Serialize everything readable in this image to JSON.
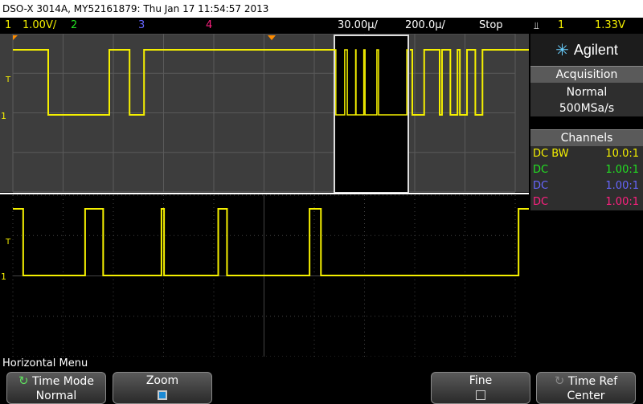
{
  "title": "DSO-X 3014A, MY52161879: Thu Jan 17 11:54:57 2013",
  "status": {
    "ch1_num": "1",
    "ch1_scale": "1.00V/",
    "ch2_num": "2",
    "ch3_num": "3",
    "ch4_num": "4",
    "time_scale": "30.00µ/",
    "time_delay": "200.0µ/",
    "run_state": "Stop",
    "trig_source": "1",
    "trig_level": "1.33V",
    "trig_slope_icon": "rising-edge-icon"
  },
  "markers": {
    "trigger_label": "T",
    "ground_label": "1"
  },
  "brand": "Agilent",
  "acquisition": {
    "header": "Acquisition",
    "mode": "Normal",
    "rate": "500MSa/s"
  },
  "channels": {
    "header": "Channels",
    "rows": [
      {
        "coupling": "DC",
        "extra": "BW",
        "probe": "10.0:1",
        "color": "#f5f000"
      },
      {
        "coupling": "DC",
        "extra": "",
        "probe": "1.00:1",
        "color": "#22e022"
      },
      {
        "coupling": "DC",
        "extra": "",
        "probe": "1.00:1",
        "color": "#6666ff"
      },
      {
        "coupling": "DC",
        "extra": "",
        "probe": "1.00:1",
        "color": "#ff2080"
      }
    ]
  },
  "horizontal_menu": "Horizontal Menu",
  "softkeys": {
    "time_mode": {
      "label": "Time Mode",
      "value": "Normal"
    },
    "zoom": {
      "label": "Zoom",
      "checked": true
    },
    "fine": {
      "label": "Fine",
      "checked": false
    },
    "time_ref": {
      "label": "Time Ref",
      "value": "Center"
    }
  },
  "colors": {
    "ch1": "#f5f000",
    "ch2": "#22e022",
    "ch3": "#6666ff",
    "ch4": "#ff2080",
    "trigger": "#ff8c00"
  },
  "waveforms": {
    "upper": {
      "transitions": [
        0.11,
        0.3,
        0.363,
        0.408
      ]
    },
    "zoomed": {
      "transitions": [
        0.02,
        0.14,
        0.175,
        0.288,
        0.293,
        0.398,
        0.415,
        0.575,
        0.597,
        0.98
      ]
    }
  }
}
